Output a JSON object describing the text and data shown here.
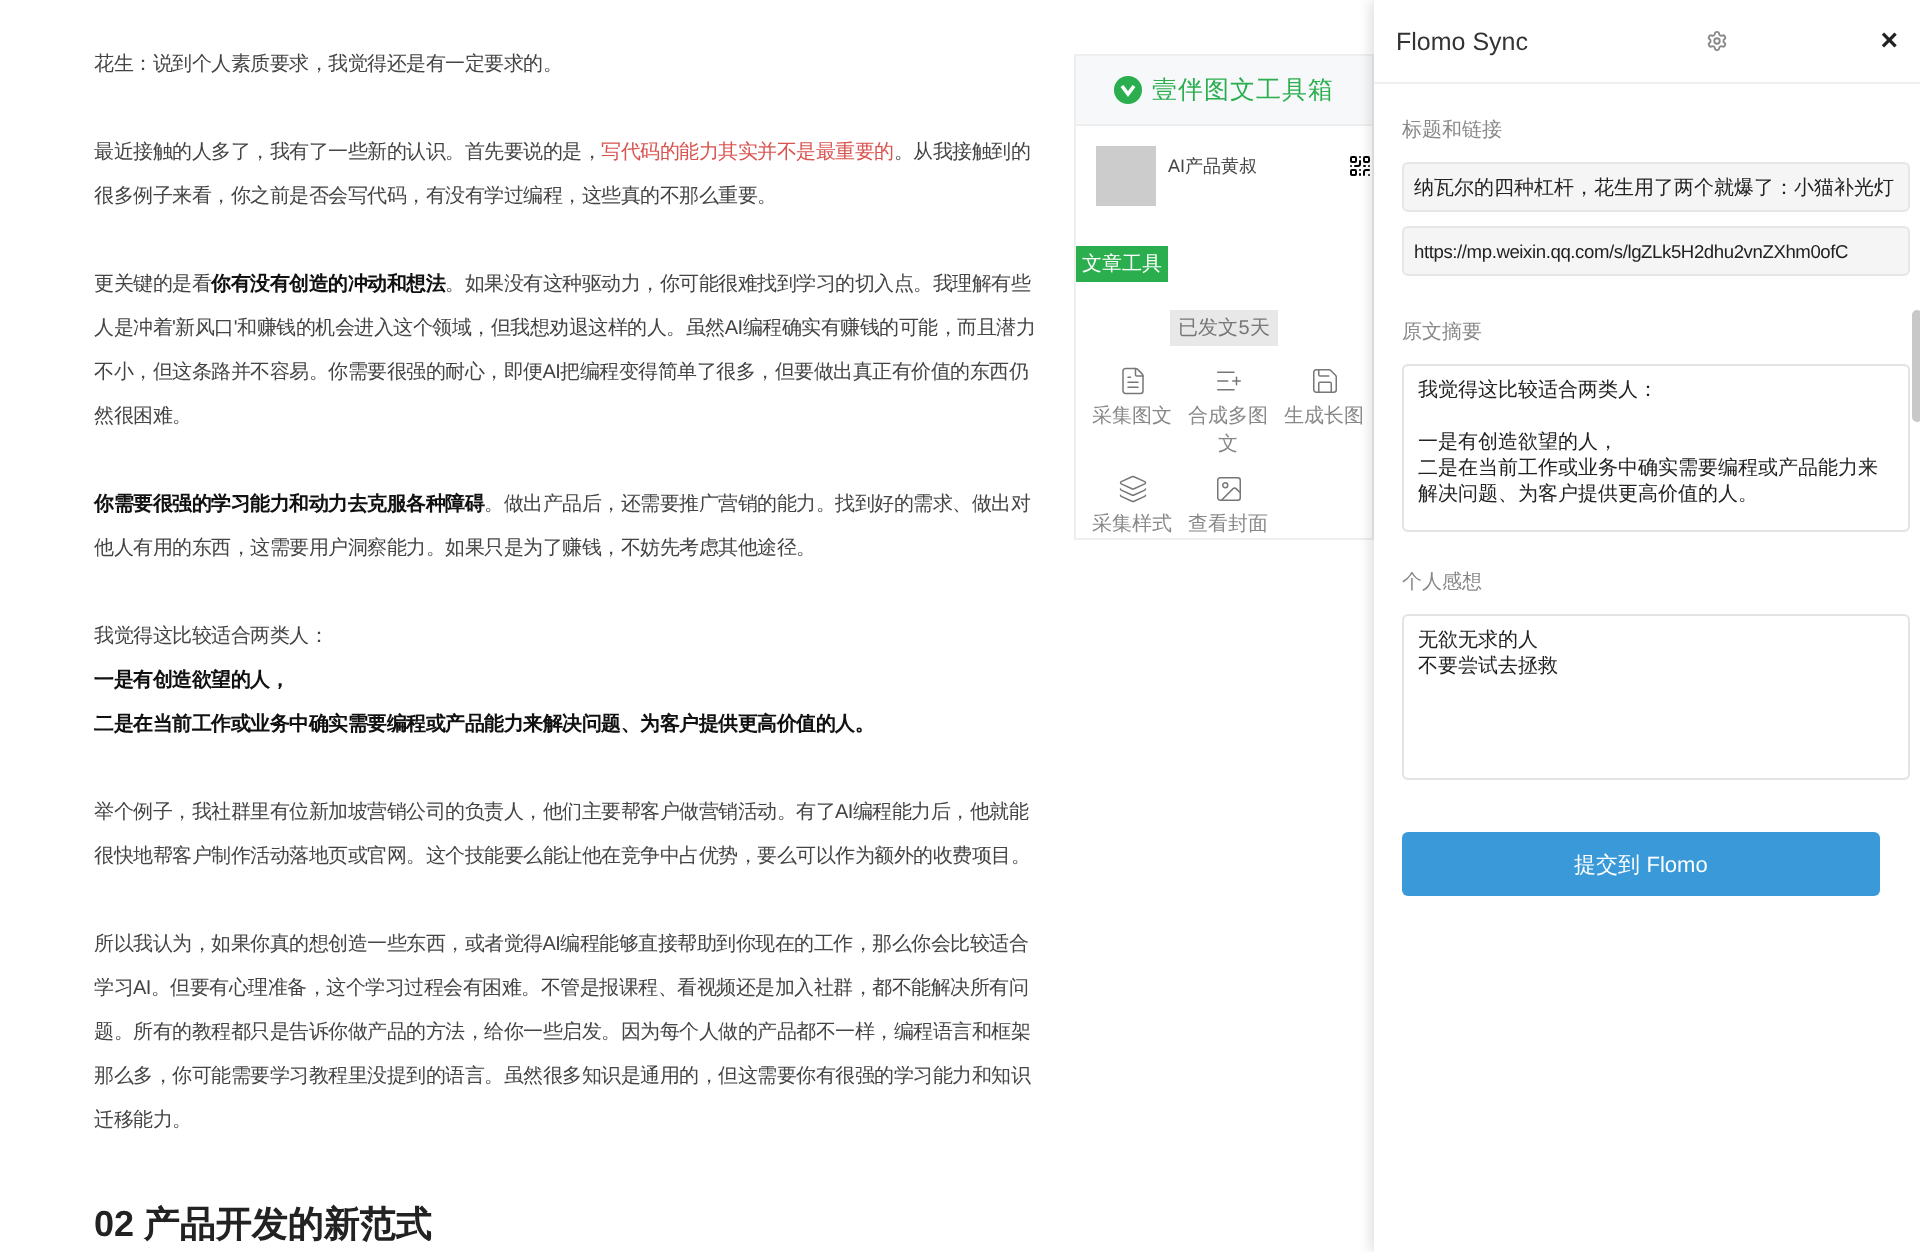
{
  "article": {
    "paragraphs": [
      {
        "segments": [
          {
            "kind": "plain",
            "text": "花生：说到个人素质要求，我觉得还是有一定要求的。"
          }
        ]
      },
      {
        "segments": [
          {
            "kind": "plain",
            "text": "最近接触的人多了，我有了一些新的认识。首先要说的是，"
          },
          {
            "kind": "red",
            "text": "写代码的能力其实并不是最重要的"
          },
          {
            "kind": "plain",
            "text": "。从我接触到的很多例子来看，你之前是否会写代码，有没有学过编程，这些真的不那么重要。"
          }
        ]
      },
      {
        "segments": [
          {
            "kind": "plain",
            "text": "更关键的是看"
          },
          {
            "kind": "bold",
            "text": "你有没有创造的冲动和想法"
          },
          {
            "kind": "plain",
            "text": "。如果没有这种驱动力，你可能很难找到学习的切入点。我理解有些人是冲着'新风口'和赚钱的机会进入这个领域，但我想劝退这样的人。虽然AI编程确实有赚钱的可能，而且潜力不小，但这条路并不容易。你需要很强的耐心，即便AI把编程变得简单了很多，但要做出真正有价值的东西仍然很困难。"
          }
        ]
      },
      {
        "segments": [
          {
            "kind": "bold",
            "text": "你需要很强的学习能力和动力去克服各种障碍"
          },
          {
            "kind": "plain",
            "text": "。做出产品后，还需要推广营销的能力。找到好的需求、做出对他人有用的东西，这需要用户洞察能力。如果只是为了赚钱，不妨先考虑其他途径。"
          }
        ]
      },
      {
        "lines": [
          {
            "segments": [
              {
                "kind": "plain",
                "text": "我觉得这比较适合两类人："
              }
            ]
          },
          {
            "segments": [
              {
                "kind": "bold",
                "text": "一是有创造欲望的人，"
              }
            ]
          },
          {
            "segments": [
              {
                "kind": "bold",
                "text": "二是在当前工作或业务中确实需要编程或产品能力来解决问题、为客户提供更高价值的人。"
              }
            ]
          }
        ]
      },
      {
        "segments": [
          {
            "kind": "plain",
            "text": "举个例子，我社群里有位新加坡营销公司的负责人，他们主要帮客户做营销活动。有了AI编程能力后，他就能很快地帮客户制作活动落地页或官网。这个技能要么能让他在竞争中占优势，要么可以作为额外的收费项目。"
          }
        ]
      },
      {
        "segments": [
          {
            "kind": "plain",
            "text": "所以我认为，如果你真的想创造一些东西，或者觉得AI编程能够直接帮助到你现在的工作，那么你会比较适合学习AI。但要有心理准备，这个学习过程会有困难。不管是报课程、看视频还是加入社群，都不能解决所有问题。所有的教程都只是告诉你做产品的方法，给你一些启发。因为每个人做的产品都不一样，编程语言和框架那么多，你可能需要学习教程里没提到的语言。虽然很多知识是通用的，但这需要你有很强的学习能力和知识迁移能力。"
          }
        ]
      }
    ],
    "heading": "02 产品开发的新范式"
  },
  "toolbox": {
    "title": "壹伴图文工具箱",
    "account": "AI产品黄叔",
    "section_tag": "文章工具",
    "post_age": "已发文5天",
    "tools": [
      {
        "kind": "collect",
        "label": "采集图文"
      },
      {
        "kind": "merge",
        "label": "合成多图文"
      },
      {
        "kind": "long",
        "label": "生成长图"
      },
      {
        "kind": "style",
        "label": "采集样式"
      },
      {
        "kind": "cover",
        "label": "查看封面"
      }
    ]
  },
  "panel": {
    "title": "Flomo Sync",
    "close": "×",
    "title_link_label": "标题和链接",
    "title_value": "纳瓦尔的四种杠杆，花生用了两个就爆了：小猫补光灯",
    "link_value": "https://mp.weixin.qq.com/s/lgZLk5H2dhu2vnZXhm0ofC",
    "summary_label": "原文摘要",
    "summary_paragraphs": [
      [
        "我觉得这比较适合两类人："
      ],
      [
        "一是有创造欲望的人，",
        "二是在当前工作或业务中确实需要编程或产品能力来解决问题、为客户提供更高价值的人。"
      ]
    ],
    "thoughts_label": "个人感想",
    "thoughts_lines": [
      "无欲无求的人",
      "不要尝试去拯救"
    ],
    "submit": "提交到 Flomo"
  }
}
